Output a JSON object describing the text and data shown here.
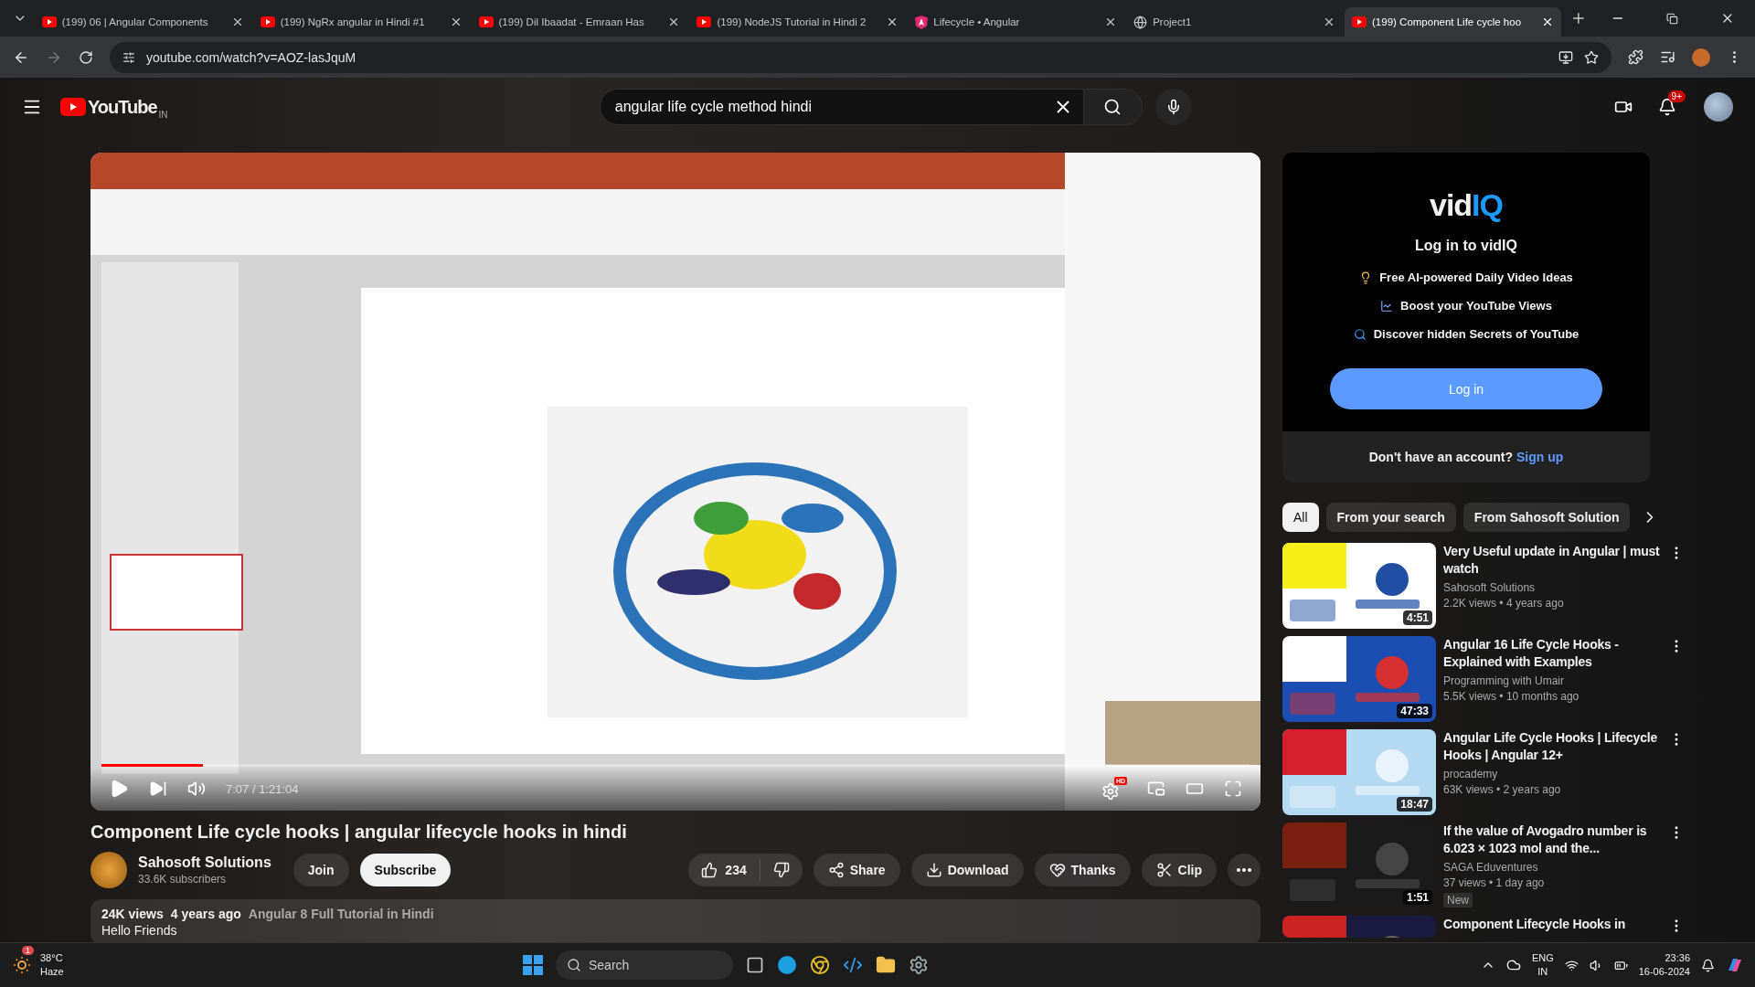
{
  "browser": {
    "tabs": [
      {
        "title": "(199) 06 | Angular Components",
        "kind": "video",
        "selected": false
      },
      {
        "title": "(199) NgRx angular in Hindi #1",
        "kind": "video",
        "selected": false
      },
      {
        "title": "(199) Dil Ibaadat - Emraan Has",
        "kind": "video",
        "selected": false
      },
      {
        "title": "(199) NodeJS Tutorial in Hindi 2",
        "kind": "video",
        "selected": false
      },
      {
        "title": "Lifecycle • Angular",
        "kind": "docs",
        "selected": false
      },
      {
        "title": "Project1",
        "kind": "local",
        "selected": false
      },
      {
        "title": "(199) Component Life cycle hoo",
        "kind": "video",
        "selected": true
      }
    ],
    "address": "youtube.com/watch?v=AOZ-lasJquM"
  },
  "header": {
    "logo": "YouTube",
    "region": "IN",
    "search": {
      "value": "angular life cycle method hindi"
    },
    "notifications": "9+"
  },
  "player": {
    "time": "7:07 / 1:21:04",
    "level": 0.088,
    "quality_badge": "HD"
  },
  "video": {
    "title": "Component Life cycle hooks | angular lifecycle hooks in hindi",
    "channel": {
      "name": "Sahosoft Solutions",
      "subscribers": "33.6K subscribers"
    },
    "join": "Join",
    "subscribe": "Subscribe",
    "likes": "234",
    "actions": [
      {
        "kind": "share",
        "label": "Share"
      },
      {
        "kind": "download",
        "label": "Download"
      },
      {
        "kind": "thanks",
        "label": "Thanks"
      },
      {
        "kind": "clip",
        "label": "Clip"
      }
    ],
    "description": {
      "views": "24K views",
      "age": "4 years ago",
      "playlist": "Angular 8 Full Tutorial in Hindi",
      "text": "Hello Friends"
    }
  },
  "vidiq": {
    "logo_left": "vid",
    "logo_right": "IQ",
    "heading": "Log in to vidIQ",
    "features": [
      {
        "kind": "idea",
        "text": "Free AI-powered Daily Video Ideas"
      },
      {
        "kind": "chart",
        "text": "Boost your YouTube Views"
      },
      {
        "kind": "search",
        "text": "Discover hidden Secrets of YouTube"
      }
    ],
    "login": "Log in",
    "signup_prompt": "Don't have an account?",
    "signup": "Sign up"
  },
  "chips": [
    {
      "label": "All",
      "selected": true
    },
    {
      "label": "From your search",
      "selected": false
    },
    {
      "label": "From Sahosoft Solution",
      "selected": false
    }
  ],
  "recommendations": [
    {
      "title": "Very Useful update in Angular | must watch",
      "channel": "Sahosoft Solutions",
      "stats": "2.2K views • 4 years ago",
      "duration": "4:51"
    },
    {
      "title": "Angular 16 Life Cycle Hooks - Explained with Examples",
      "channel": "Programming with Umair",
      "stats": "5.5K views • 10 months ago",
      "duration": "47:33"
    },
    {
      "title": "Angular Life Cycle Hooks | Lifecycle Hooks | Angular 12+",
      "channel": "procademy",
      "stats": "63K views • 2 years ago",
      "duration": "18:47"
    },
    {
      "title": "If the value of Avogadro number is 6.023 × 1023 mol and the...",
      "channel": "SAGA Eduventures",
      "stats": "37 views • 1 day ago",
      "duration": "1:51",
      "badge": "New"
    },
    {
      "title": "Component Lifecycle Hooks in"
    }
  ],
  "taskbar": {
    "weather": {
      "temp": "38°C",
      "condition": "Haze",
      "badge": "1"
    },
    "search": "Search",
    "language": [
      "ENG",
      "IN"
    ],
    "time": "23:36",
    "date": "16-06-2024"
  }
}
